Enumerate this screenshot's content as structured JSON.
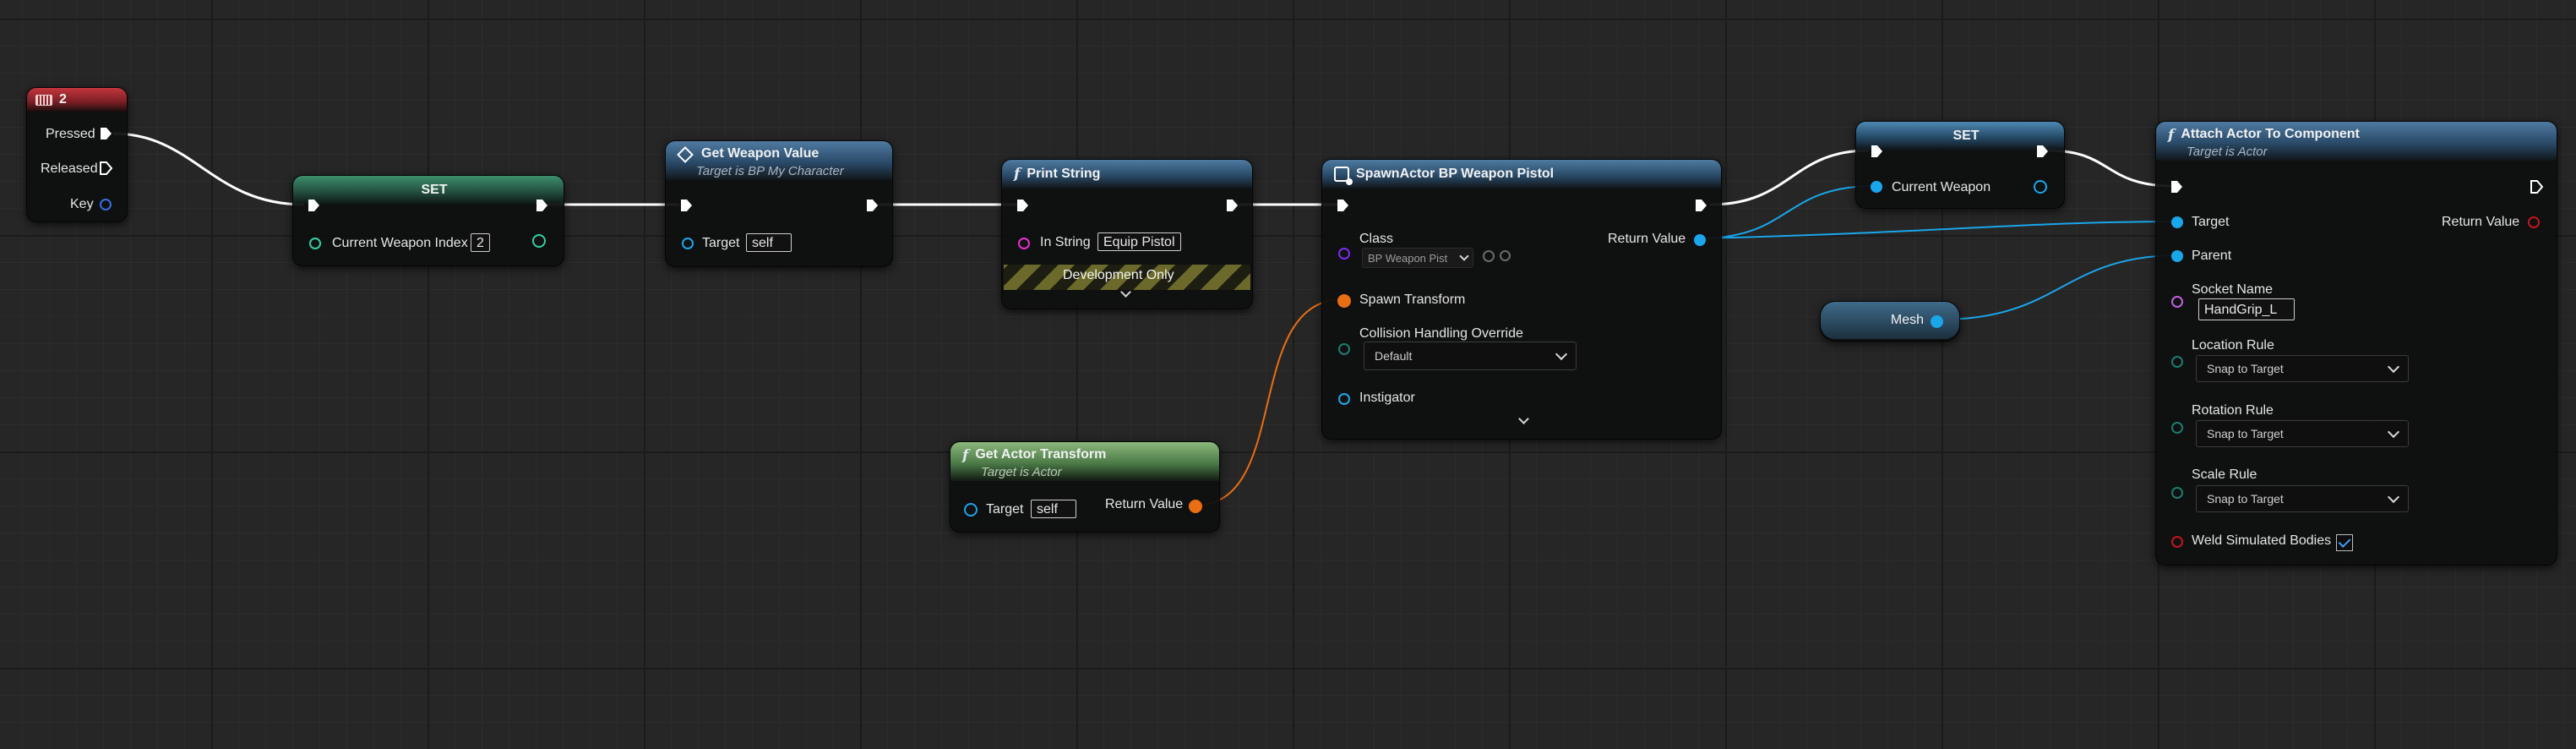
{
  "colors": {
    "exec": "#ffffff",
    "int_teal": "#2fd0a2",
    "object_blue": "#1aa6ea",
    "string_magenta": "#ee29d3",
    "transform_orange": "#ea6e13",
    "class_purple": "#7a2df0",
    "bool_red": "#c4161c",
    "key_blue": "#3a6ce0"
  },
  "nodes": {
    "key2": {
      "title": "2",
      "pressed": "Pressed",
      "released": "Released",
      "key": "Key"
    },
    "set_index": {
      "title": "SET",
      "var_label": "Current Weapon Index",
      "var_value": "2"
    },
    "get_weapon": {
      "title": "Get Weapon Value",
      "subtitle": "Target is BP My Character",
      "target_label": "Target",
      "target_value": "self"
    },
    "print_string": {
      "title": "Print String",
      "in_string_label": "In String",
      "in_string_value": "Equip Pistol",
      "dev_only": "Development Only"
    },
    "spawn_actor": {
      "title": "SpawnActor BP Weapon Pistol",
      "class_label": "Class",
      "class_value": "BP Weapon Pist",
      "return_label": "Return Value",
      "spawn_transform": "Spawn Transform",
      "collision_label": "Collision Handling Override",
      "collision_value": "Default",
      "instigator": "Instigator"
    },
    "get_actor_transform": {
      "title": "Get Actor Transform",
      "subtitle": "Target is Actor",
      "target_label": "Target",
      "target_value": "self",
      "return_label": "Return Value"
    },
    "set_weapon": {
      "title": "SET",
      "var_label": "Current Weapon"
    },
    "mesh": {
      "title": "Mesh"
    },
    "attach": {
      "title": "Attach Actor To Component",
      "subtitle": "Target is Actor",
      "target_label": "Target",
      "return_label": "Return Value",
      "parent_label": "Parent",
      "socket_label": "Socket Name",
      "socket_value": "HandGrip_L",
      "location_label": "Location Rule",
      "location_value": "Snap to Target",
      "rotation_label": "Rotation Rule",
      "rotation_value": "Snap to Target",
      "scale_label": "Scale Rule",
      "scale_value": "Snap to Target",
      "weld_label": "Weld Simulated Bodies",
      "weld_checked": true
    }
  }
}
